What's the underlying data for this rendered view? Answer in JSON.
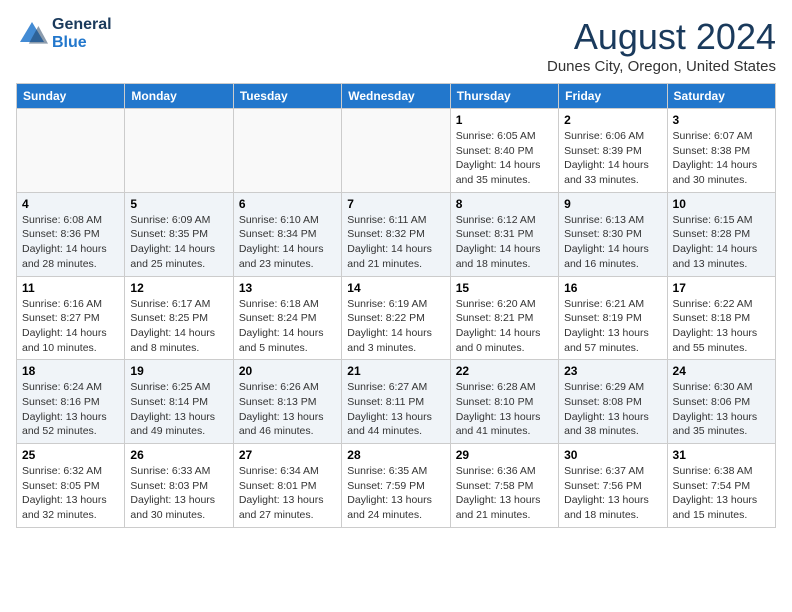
{
  "header": {
    "logo_line1": "General",
    "logo_line2": "Blue",
    "month_year": "August 2024",
    "location": "Dunes City, Oregon, United States"
  },
  "weekdays": [
    "Sunday",
    "Monday",
    "Tuesday",
    "Wednesday",
    "Thursday",
    "Friday",
    "Saturday"
  ],
  "weeks": [
    [
      {
        "day": "",
        "sunrise": "",
        "sunset": "",
        "daylight": ""
      },
      {
        "day": "",
        "sunrise": "",
        "sunset": "",
        "daylight": ""
      },
      {
        "day": "",
        "sunrise": "",
        "sunset": "",
        "daylight": ""
      },
      {
        "day": "",
        "sunrise": "",
        "sunset": "",
        "daylight": ""
      },
      {
        "day": "1",
        "sunrise": "Sunrise: 6:05 AM",
        "sunset": "Sunset: 8:40 PM",
        "daylight": "Daylight: 14 hours and 35 minutes."
      },
      {
        "day": "2",
        "sunrise": "Sunrise: 6:06 AM",
        "sunset": "Sunset: 8:39 PM",
        "daylight": "Daylight: 14 hours and 33 minutes."
      },
      {
        "day": "3",
        "sunrise": "Sunrise: 6:07 AM",
        "sunset": "Sunset: 8:38 PM",
        "daylight": "Daylight: 14 hours and 30 minutes."
      }
    ],
    [
      {
        "day": "4",
        "sunrise": "Sunrise: 6:08 AM",
        "sunset": "Sunset: 8:36 PM",
        "daylight": "Daylight: 14 hours and 28 minutes."
      },
      {
        "day": "5",
        "sunrise": "Sunrise: 6:09 AM",
        "sunset": "Sunset: 8:35 PM",
        "daylight": "Daylight: 14 hours and 25 minutes."
      },
      {
        "day": "6",
        "sunrise": "Sunrise: 6:10 AM",
        "sunset": "Sunset: 8:34 PM",
        "daylight": "Daylight: 14 hours and 23 minutes."
      },
      {
        "day": "7",
        "sunrise": "Sunrise: 6:11 AM",
        "sunset": "Sunset: 8:32 PM",
        "daylight": "Daylight: 14 hours and 21 minutes."
      },
      {
        "day": "8",
        "sunrise": "Sunrise: 6:12 AM",
        "sunset": "Sunset: 8:31 PM",
        "daylight": "Daylight: 14 hours and 18 minutes."
      },
      {
        "day": "9",
        "sunrise": "Sunrise: 6:13 AM",
        "sunset": "Sunset: 8:30 PM",
        "daylight": "Daylight: 14 hours and 16 minutes."
      },
      {
        "day": "10",
        "sunrise": "Sunrise: 6:15 AM",
        "sunset": "Sunset: 8:28 PM",
        "daylight": "Daylight: 14 hours and 13 minutes."
      }
    ],
    [
      {
        "day": "11",
        "sunrise": "Sunrise: 6:16 AM",
        "sunset": "Sunset: 8:27 PM",
        "daylight": "Daylight: 14 hours and 10 minutes."
      },
      {
        "day": "12",
        "sunrise": "Sunrise: 6:17 AM",
        "sunset": "Sunset: 8:25 PM",
        "daylight": "Daylight: 14 hours and 8 minutes."
      },
      {
        "day": "13",
        "sunrise": "Sunrise: 6:18 AM",
        "sunset": "Sunset: 8:24 PM",
        "daylight": "Daylight: 14 hours and 5 minutes."
      },
      {
        "day": "14",
        "sunrise": "Sunrise: 6:19 AM",
        "sunset": "Sunset: 8:22 PM",
        "daylight": "Daylight: 14 hours and 3 minutes."
      },
      {
        "day": "15",
        "sunrise": "Sunrise: 6:20 AM",
        "sunset": "Sunset: 8:21 PM",
        "daylight": "Daylight: 14 hours and 0 minutes."
      },
      {
        "day": "16",
        "sunrise": "Sunrise: 6:21 AM",
        "sunset": "Sunset: 8:19 PM",
        "daylight": "Daylight: 13 hours and 57 minutes."
      },
      {
        "day": "17",
        "sunrise": "Sunrise: 6:22 AM",
        "sunset": "Sunset: 8:18 PM",
        "daylight": "Daylight: 13 hours and 55 minutes."
      }
    ],
    [
      {
        "day": "18",
        "sunrise": "Sunrise: 6:24 AM",
        "sunset": "Sunset: 8:16 PM",
        "daylight": "Daylight: 13 hours and 52 minutes."
      },
      {
        "day": "19",
        "sunrise": "Sunrise: 6:25 AM",
        "sunset": "Sunset: 8:14 PM",
        "daylight": "Daylight: 13 hours and 49 minutes."
      },
      {
        "day": "20",
        "sunrise": "Sunrise: 6:26 AM",
        "sunset": "Sunset: 8:13 PM",
        "daylight": "Daylight: 13 hours and 46 minutes."
      },
      {
        "day": "21",
        "sunrise": "Sunrise: 6:27 AM",
        "sunset": "Sunset: 8:11 PM",
        "daylight": "Daylight: 13 hours and 44 minutes."
      },
      {
        "day": "22",
        "sunrise": "Sunrise: 6:28 AM",
        "sunset": "Sunset: 8:10 PM",
        "daylight": "Daylight: 13 hours and 41 minutes."
      },
      {
        "day": "23",
        "sunrise": "Sunrise: 6:29 AM",
        "sunset": "Sunset: 8:08 PM",
        "daylight": "Daylight: 13 hours and 38 minutes."
      },
      {
        "day": "24",
        "sunrise": "Sunrise: 6:30 AM",
        "sunset": "Sunset: 8:06 PM",
        "daylight": "Daylight: 13 hours and 35 minutes."
      }
    ],
    [
      {
        "day": "25",
        "sunrise": "Sunrise: 6:32 AM",
        "sunset": "Sunset: 8:05 PM",
        "daylight": "Daylight: 13 hours and 32 minutes."
      },
      {
        "day": "26",
        "sunrise": "Sunrise: 6:33 AM",
        "sunset": "Sunset: 8:03 PM",
        "daylight": "Daylight: 13 hours and 30 minutes."
      },
      {
        "day": "27",
        "sunrise": "Sunrise: 6:34 AM",
        "sunset": "Sunset: 8:01 PM",
        "daylight": "Daylight: 13 hours and 27 minutes."
      },
      {
        "day": "28",
        "sunrise": "Sunrise: 6:35 AM",
        "sunset": "Sunset: 7:59 PM",
        "daylight": "Daylight: 13 hours and 24 minutes."
      },
      {
        "day": "29",
        "sunrise": "Sunrise: 6:36 AM",
        "sunset": "Sunset: 7:58 PM",
        "daylight": "Daylight: 13 hours and 21 minutes."
      },
      {
        "day": "30",
        "sunrise": "Sunrise: 6:37 AM",
        "sunset": "Sunset: 7:56 PM",
        "daylight": "Daylight: 13 hours and 18 minutes."
      },
      {
        "day": "31",
        "sunrise": "Sunrise: 6:38 AM",
        "sunset": "Sunset: 7:54 PM",
        "daylight": "Daylight: 13 hours and 15 minutes."
      }
    ]
  ]
}
